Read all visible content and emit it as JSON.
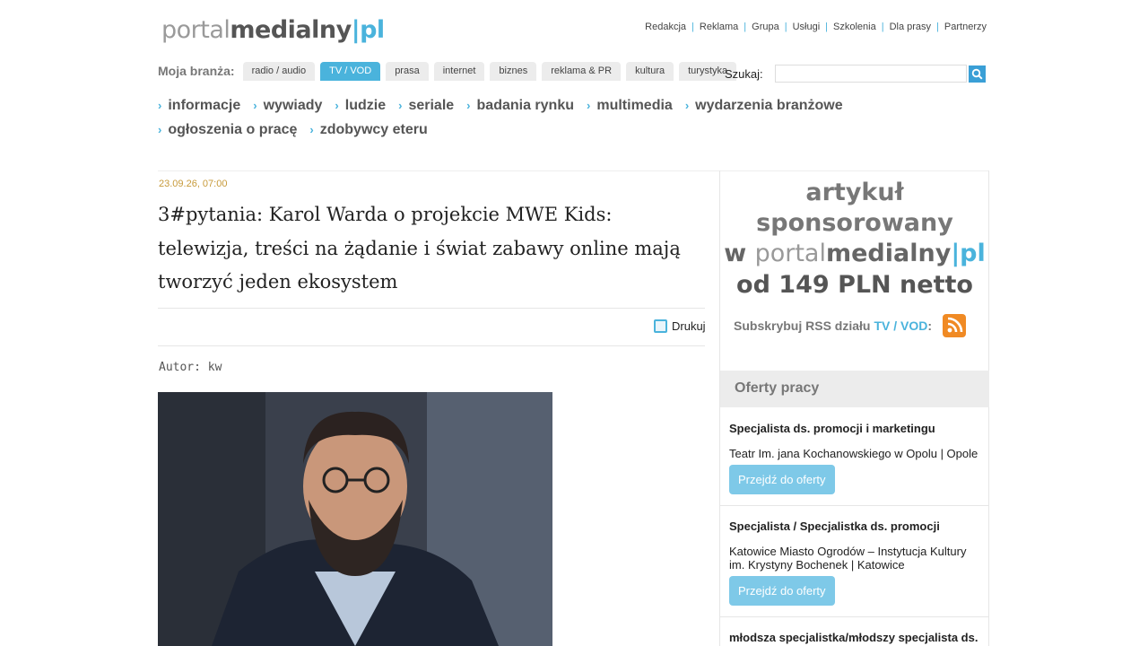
{
  "logo": {
    "part1": "portal",
    "part2": "medialny",
    "part3": "|pl"
  },
  "topnav": [
    "Redakcja",
    "Reklama",
    "Grupa",
    "Usługi",
    "Szkolenia",
    "Dla prasy",
    "Partnerzy"
  ],
  "branza": {
    "label": "Moja branża:",
    "tabs": [
      "radio / audio",
      "TV / VOD",
      "prasa",
      "internet",
      "biznes",
      "reklama & PR",
      "kultura",
      "turystyka"
    ],
    "active": "TV / VOD"
  },
  "search": {
    "label": "Szukaj:",
    "placeholder": ""
  },
  "mainnav": {
    "row1": [
      "informacje",
      "wywiady",
      "ludzie",
      "seriale",
      "badania rynku",
      "multimedia",
      "wydarzenia branżowe"
    ],
    "row2": [
      "ogłoszenia o pracę",
      "zdobywcy eteru"
    ]
  },
  "article": {
    "date": "23.09.26, 07:00",
    "title": "3#pytania: Karol Warda o projekcie MWE Kids: telewizja, treści na żądanie i świat zabawy online mają tworzyć jeden ekosystem",
    "print_label": "Drukuj",
    "author": "Autor: kw"
  },
  "sidebar": {
    "ad": {
      "line1": "artykuł sponsorowany",
      "line2_prefix": "w ",
      "line2_logo1": "portal",
      "line2_logo2": "medialny",
      "line2_logo3": "|pl",
      "line3": "od 149 PLN netto"
    },
    "rss": {
      "label": "Subskrybuj RSS działu",
      "section": "TV / VOD",
      "colon": ":"
    },
    "oferty_title": "Oferty pracy",
    "jobs": [
      {
        "title": "Specjalista ds. promocji i marketingu",
        "company": "Teatr Im. jana Kochanowskiego w Opolu | Opole",
        "button": "Przejdź do oferty"
      },
      {
        "title": "Specjalista / Specjalistka ds. promocji",
        "company": "Katowice Miasto Ogrodów – Instytucja Kultury im. Krystyny Bochenek | Katowice",
        "button": "Przejdź do oferty"
      },
      {
        "title": "młodsza specjalistka/młodszy specjalista ds."
      }
    ]
  },
  "colors": {
    "accent": "#4ab3dc",
    "date": "#c79a3a",
    "rss": "#f08a24"
  }
}
